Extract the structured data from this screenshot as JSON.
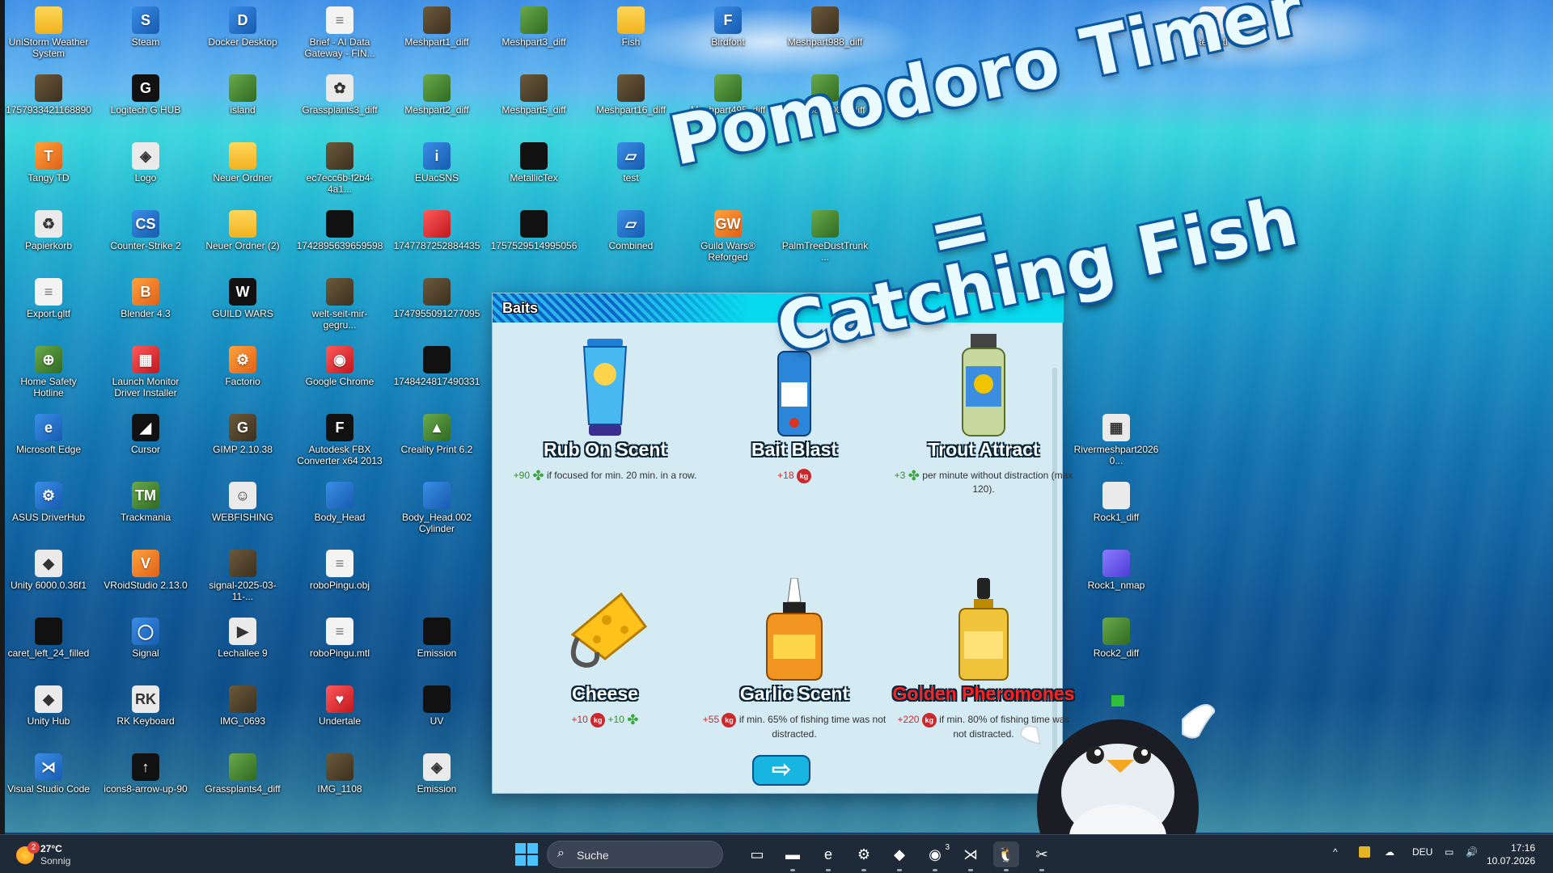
{
  "desktop_icons": [
    {
      "label": "UniStorm Weather System",
      "icon": "folder-icon",
      "kind": "fold",
      "glyph": ""
    },
    {
      "label": "Steam",
      "icon": "steam-icon",
      "kind": "blu",
      "glyph": "S"
    },
    {
      "label": "Docker Desktop",
      "icon": "docker-icon",
      "kind": "blu",
      "glyph": "D"
    },
    {
      "label": "Brief - AI Data Gateway - FIN...",
      "icon": "document-icon",
      "kind": "file",
      "glyph": "≡"
    },
    {
      "label": "Meshpart1_diff",
      "icon": "texture-icon",
      "kind": "img",
      "glyph": ""
    },
    {
      "label": "Meshpart3_diff",
      "icon": "texture-icon",
      "kind": "grn",
      "glyph": ""
    },
    {
      "label": "Fish",
      "icon": "folder-icon",
      "kind": "fold",
      "glyph": ""
    },
    {
      "label": "Birdfont",
      "icon": "birdfont-icon",
      "kind": "blu",
      "glyph": "F"
    },
    {
      "label": "Meshpart988_diff",
      "icon": "texture-icon",
      "kind": "img",
      "glyph": ""
    },
    {
      "label": "testmtl",
      "icon": "document-icon",
      "kind": "file",
      "glyph": "≡"
    },
    {
      "label": "1757933421168890",
      "icon": "image-icon",
      "kind": "img",
      "glyph": ""
    },
    {
      "label": "Logitech G HUB",
      "icon": "logitech-icon",
      "kind": "drk",
      "glyph": "G"
    },
    {
      "label": "island",
      "icon": "image-icon",
      "kind": "grn",
      "glyph": ""
    },
    {
      "label": "Grassplants3_diff",
      "icon": "texture-icon",
      "kind": "wht",
      "glyph": "✿"
    },
    {
      "label": "Meshpart2_diff",
      "icon": "texture-icon",
      "kind": "grn",
      "glyph": ""
    },
    {
      "label": "Meshpart5_diff",
      "icon": "texture-icon",
      "kind": "img",
      "glyph": ""
    },
    {
      "label": "Meshpart16_diff",
      "icon": "texture-icon",
      "kind": "img",
      "glyph": ""
    },
    {
      "label": "Meshpart495_diff",
      "icon": "texture-icon",
      "kind": "grn",
      "glyph": ""
    },
    {
      "label": "Meshpart1007_diff",
      "icon": "texture-icon",
      "kind": "grn",
      "glyph": ""
    },
    {
      "label": "Tangy TD",
      "icon": "game-icon",
      "kind": "org",
      "glyph": "T"
    },
    {
      "label": "Logo",
      "icon": "logo-icon",
      "kind": "wht",
      "glyph": "◈"
    },
    {
      "label": "Neuer Ordner",
      "icon": "folder-icon",
      "kind": "fold",
      "glyph": ""
    },
    {
      "label": "ec7ecc6b-f2b4-4a1...",
      "icon": "image-icon",
      "kind": "img",
      "glyph": ""
    },
    {
      "label": "EUacSNS",
      "icon": "file-icon",
      "kind": "blu",
      "glyph": "i"
    },
    {
      "label": "MetallicTex",
      "icon": "image-icon",
      "kind": "drk",
      "glyph": ""
    },
    {
      "label": "test",
      "icon": "shortcut-icon",
      "kind": "blu",
      "glyph": "▱"
    },
    {
      "label": "Papierkorb",
      "icon": "recycle-bin-icon",
      "kind": "wht",
      "glyph": "♻"
    },
    {
      "label": "Counter-Strike 2",
      "icon": "game-icon",
      "kind": "blu",
      "glyph": "CS"
    },
    {
      "label": "Neuer Ordner (2)",
      "icon": "folder-icon",
      "kind": "fold",
      "glyph": ""
    },
    {
      "label": "1742895639659598",
      "icon": "image-icon",
      "kind": "drk",
      "glyph": ""
    },
    {
      "label": "1747787252884435",
      "icon": "image-icon",
      "kind": "red",
      "glyph": ""
    },
    {
      "label": "1757529514995056",
      "icon": "image-icon",
      "kind": "drk",
      "glyph": ""
    },
    {
      "label": "Combined",
      "icon": "shortcut-icon",
      "kind": "blu",
      "glyph": "▱"
    },
    {
      "label": "Guild Wars® Reforged",
      "icon": "game-icon",
      "kind": "org",
      "glyph": "GW"
    },
    {
      "label": "PalmTreeDustTrunk...",
      "icon": "texture-icon",
      "kind": "grn",
      "glyph": ""
    },
    {
      "label": "Export.gltf",
      "icon": "document-icon",
      "kind": "file",
      "glyph": "≡"
    },
    {
      "label": "Blender 4.3",
      "icon": "blender-icon",
      "kind": "org",
      "glyph": "B"
    },
    {
      "label": "GUILD WARS",
      "icon": "game-icon",
      "kind": "drk",
      "glyph": "W"
    },
    {
      "label": "welt-seit-mir-gegru...",
      "icon": "image-icon",
      "kind": "img",
      "glyph": ""
    },
    {
      "label": "1747955091277095",
      "icon": "image-icon",
      "kind": "img",
      "glyph": ""
    },
    {
      "label": "Home Safety Hotline",
      "icon": "game-icon",
      "kind": "grn",
      "glyph": "⊕"
    },
    {
      "label": "Launch Monitor Driver Installer",
      "icon": "installer-icon",
      "kind": "red",
      "glyph": "▦"
    },
    {
      "label": "Factorio",
      "icon": "game-icon",
      "kind": "org",
      "glyph": "⚙"
    },
    {
      "label": "Google Chrome",
      "icon": "chrome-icon",
      "kind": "red",
      "glyph": "◉"
    },
    {
      "label": "1748424817490331",
      "icon": "image-icon",
      "kind": "drk",
      "glyph": ""
    },
    {
      "label": "Microsoft Edge",
      "icon": "edge-icon",
      "kind": "blu",
      "glyph": "e"
    },
    {
      "label": "Cursor",
      "icon": "cursor-app-icon",
      "kind": "drk",
      "glyph": "◢"
    },
    {
      "label": "GIMP 2.10.38",
      "icon": "gimp-icon",
      "kind": "img",
      "glyph": "G"
    },
    {
      "label": "Autodesk FBX Converter x64 2013",
      "icon": "fbx-icon",
      "kind": "drk",
      "glyph": "F"
    },
    {
      "label": "Creality Print 6.2",
      "icon": "creality-icon",
      "kind": "grn",
      "glyph": "▲"
    },
    {
      "label": "ASUS DriverHub",
      "icon": "asus-icon",
      "kind": "blu",
      "glyph": "⚙"
    },
    {
      "label": "Trackmania",
      "icon": "game-icon",
      "kind": "grn",
      "glyph": "TM"
    },
    {
      "label": "WEBFISHING",
      "icon": "game-icon",
      "kind": "wht",
      "glyph": "☺"
    },
    {
      "label": "Body_Head",
      "icon": "model-icon",
      "kind": "blu",
      "glyph": ""
    },
    {
      "label": "Body_Head.002 Cylinder",
      "icon": "model-icon",
      "kind": "blu",
      "glyph": ""
    },
    {
      "label": "Unity 6000.0.36f1",
      "icon": "unity-icon",
      "kind": "wht",
      "glyph": "◆"
    },
    {
      "label": "VRoidStudio 2.13.0",
      "icon": "vroid-icon",
      "kind": "org",
      "glyph": "V"
    },
    {
      "label": "signal-2025-03-11-...",
      "icon": "image-icon",
      "kind": "img",
      "glyph": ""
    },
    {
      "label": "roboPingu.obj",
      "icon": "document-icon",
      "kind": "file",
      "glyph": "≡"
    },
    {
      "label": "caret_left_24_filled",
      "icon": "image-icon",
      "kind": "drk",
      "glyph": ""
    },
    {
      "label": "Signal",
      "icon": "signal-icon",
      "kind": "blu",
      "glyph": "◯"
    },
    {
      "label": "Lechallee 9",
      "icon": "video-icon",
      "kind": "wht",
      "glyph": "▶"
    },
    {
      "label": "roboPingu.mtl",
      "icon": "document-icon",
      "kind": "file",
      "glyph": "≡"
    },
    {
      "label": "Emission",
      "icon": "image-icon",
      "kind": "drk",
      "glyph": ""
    },
    {
      "label": "Unity Hub",
      "icon": "unity-icon",
      "kind": "wht",
      "glyph": "◆"
    },
    {
      "label": "RK Keyboard",
      "icon": "keyboard-icon",
      "kind": "wht",
      "glyph": "RK"
    },
    {
      "label": "IMG_0693",
      "icon": "image-icon",
      "kind": "img",
      "glyph": ""
    },
    {
      "label": "Undertale",
      "icon": "game-icon",
      "kind": "red",
      "glyph": "♥"
    },
    {
      "label": "UV",
      "icon": "image-icon",
      "kind": "drk",
      "glyph": ""
    },
    {
      "label": "Visual Studio Code",
      "icon": "vscode-icon",
      "kind": "blu",
      "glyph": "⋊"
    },
    {
      "label": "icons8-arrow-up-90",
      "icon": "image-icon",
      "kind": "drk",
      "glyph": "↑"
    },
    {
      "label": "Grassplants4_diff",
      "icon": "texture-icon",
      "kind": "grn",
      "glyph": ""
    },
    {
      "label": "IMG_1108",
      "icon": "image-icon",
      "kind": "img",
      "glyph": ""
    },
    {
      "label": "Emission",
      "icon": "logo-icon",
      "kind": "wht",
      "glyph": "◈"
    },
    {
      "label": "Rivermeshpart20260...",
      "icon": "image-icon",
      "kind": "wht",
      "glyph": "▦"
    },
    {
      "label": "Rock1_diff",
      "icon": "texture-icon",
      "kind": "wht",
      "glyph": ""
    },
    {
      "label": "Rock1_nmap",
      "icon": "texture-icon",
      "kind": "pur",
      "glyph": ""
    },
    {
      "label": "Rock2_diff",
      "icon": "texture-icon",
      "kind": "grn",
      "glyph": ""
    }
  ],
  "overlay": {
    "line1": "Pomodoro Timer",
    "line2": "=",
    "line3": "Catching Fish"
  },
  "baits_window": {
    "title": "Baits",
    "items": [
      {
        "name": "Rub On Scent",
        "kind": "tube",
        "pre": "+90",
        "clover": true,
        "coin": false,
        "text": "if focused for min. 20 min. in a row."
      },
      {
        "name": "Bait Blast",
        "kind": "can",
        "pre": "+18",
        "clover": false,
        "coin": true,
        "text": ""
      },
      {
        "name": "Trout Attract",
        "kind": "jar",
        "pre": "+3",
        "clover": true,
        "coin": false,
        "text": "per minute without distraction (max 120)."
      },
      {
        "name": "Cheese",
        "kind": "cheese",
        "pre": "+10",
        "clover": true,
        "coin": true,
        "text": "+10"
      },
      {
        "name": "Garlic Scent",
        "kind": "dropper",
        "pre": "+55",
        "clover": false,
        "coin": true,
        "text": "if min. 65% of fishing time was not distracted."
      },
      {
        "name": "Golden Pheromones",
        "kind": "gold",
        "pre": "+220",
        "clover": false,
        "coin": true,
        "text": "if min. 80% of fishing time was not distracted."
      }
    ],
    "coin_glyph": "kg",
    "next_button": "⇨"
  },
  "taskbar": {
    "weather": {
      "badge": "2",
      "temp": "27°C",
      "condition": "Sonnig"
    },
    "search_placeholder": "Suche",
    "apps": [
      {
        "icon": "task-view-icon",
        "glyph": "▭"
      },
      {
        "icon": "terminal-icon",
        "glyph": "▬"
      },
      {
        "icon": "edge-icon",
        "glyph": "e"
      },
      {
        "icon": "settings-icon",
        "glyph": "⚙"
      },
      {
        "icon": "unity-icon",
        "glyph": "◆"
      },
      {
        "icon": "discord-icon",
        "glyph": "◉",
        "badge": "3"
      },
      {
        "icon": "vscode-icon",
        "glyph": "⋊"
      },
      {
        "icon": "pomodoro-app-icon",
        "glyph": "🐧"
      },
      {
        "icon": "snipping-tool-icon",
        "glyph": "✂"
      }
    ],
    "tray": {
      "chevron": "^",
      "lang": "DEU",
      "time": "17:16",
      "date": "10.07.2026"
    }
  }
}
